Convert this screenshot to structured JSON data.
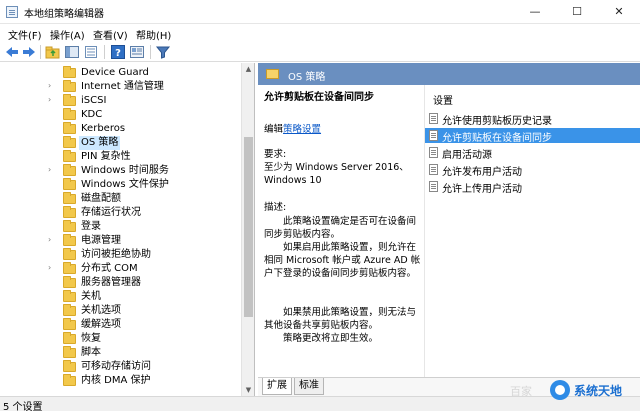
{
  "window": {
    "title": "本地组策略编辑器",
    "min_glyph": "—",
    "max_glyph": "☐",
    "close_glyph": "✕"
  },
  "menu": {
    "file": "文件(F)",
    "action": "操作(A)",
    "view": "查看(V)",
    "help": "帮助(H)"
  },
  "toolbar": {
    "icons": [
      "back-arrow-icon",
      "forward-arrow-icon",
      "up-folder-icon",
      "show-hide-tree-icon",
      "export-list-icon",
      "help-icon",
      "properties-icon",
      "filter-icon"
    ],
    "colors": {
      "arrow": "#3a7bd5",
      "filter": "#4b79b8"
    }
  },
  "tree": {
    "items": [
      {
        "label": "Device Guard",
        "expandable": false
      },
      {
        "label": "Internet 通信管理",
        "expandable": true
      },
      {
        "label": "iSCSI",
        "expandable": true
      },
      {
        "label": "KDC",
        "expandable": false
      },
      {
        "label": "Kerberos",
        "expandable": false
      },
      {
        "label": "OS 策略",
        "expandable": false,
        "selected": true
      },
      {
        "label": "PIN 复杂性",
        "expandable": false
      },
      {
        "label": "Windows 时间服务",
        "expandable": true
      },
      {
        "label": "Windows 文件保护",
        "expandable": false
      },
      {
        "label": "磁盘配额",
        "expandable": false
      },
      {
        "label": "存储运行状况",
        "expandable": false
      },
      {
        "label": "登录",
        "expandable": false
      },
      {
        "label": "电源管理",
        "expandable": true
      },
      {
        "label": "访问被拒绝协助",
        "expandable": false
      },
      {
        "label": "分布式 COM",
        "expandable": true
      },
      {
        "label": "服务器管理器",
        "expandable": false
      },
      {
        "label": "关机",
        "expandable": false
      },
      {
        "label": "关机选项",
        "expandable": false
      },
      {
        "label": "缓解选项",
        "expandable": false
      },
      {
        "label": "恢复",
        "expandable": false
      },
      {
        "label": "脚本",
        "expandable": false
      },
      {
        "label": "可移动存储访问",
        "expandable": false
      },
      {
        "label": "内核 DMA 保护",
        "expandable": false
      }
    ]
  },
  "right": {
    "header": "OS 策略",
    "policy_title": "允许剪贴板在设备间同步",
    "edit_prefix": "编辑",
    "edit_link": "策略设置",
    "req_label": "要求:",
    "req_text": "至少为 Windows Server 2016、Windows 10",
    "desc_label": "描述:",
    "desc_paras": [
      "此策略设置确定是否可在设备间同步剪贴板内容。",
      "如果启用此策略设置，则允许在相同 Microsoft 帐户或 Azure AD 帐户下登录的设备间同步剪贴板内容。",
      "如果禁用此策略设置，则无法与其他设备共享剪贴板内容。",
      "策略更改将立即生效。"
    ],
    "list_header": "设置",
    "settings": [
      {
        "label": "允许使用剪贴板历史记录",
        "selected": false
      },
      {
        "label": "允许剪贴板在设备间同步",
        "selected": true
      },
      {
        "label": "启用活动源",
        "selected": false
      },
      {
        "label": "允许发布用户活动",
        "selected": false
      },
      {
        "label": "允许上传用户活动",
        "selected": false
      }
    ],
    "tabs": {
      "extended": "扩展",
      "standard": "标准"
    }
  },
  "status": {
    "text": "5 个设置"
  },
  "watermark": {
    "faint": "百家",
    "brand": "系统天地"
  }
}
